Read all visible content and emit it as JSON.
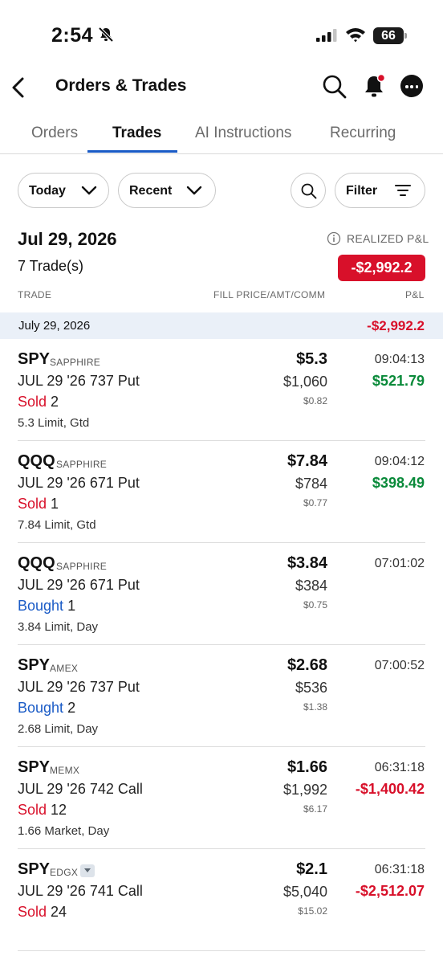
{
  "status_bar": {
    "time": "2:54",
    "battery": "66"
  },
  "header": {
    "title": "Orders & Trades"
  },
  "tabs": [
    {
      "label": "Orders"
    },
    {
      "label": "Trades",
      "active": true
    },
    {
      "label": "AI Instructions"
    },
    {
      "label": "Recurring"
    }
  ],
  "filters": {
    "period": "Today",
    "sort": "Recent",
    "filter_label": "Filter"
  },
  "summary": {
    "date": "Jul 29, 2026",
    "trade_count": "7 Trade(s)",
    "realized_label": "REALIZED P&L",
    "realized_value": "-$2,992.2"
  },
  "columns": {
    "trade": "TRADE",
    "fill": "FILL PRICE/AMT/COMM",
    "pl": "P&L"
  },
  "group": {
    "date": "July 29, 2026",
    "pl": "-$2,992.2"
  },
  "trades": [
    {
      "symbol": "SPY",
      "exchange": "SAPPHIRE",
      "contract": "JUL 29 '26 737 Put",
      "side": "Sold",
      "qty": "2",
      "order": "5.3 Limit, Gtd",
      "fill": "$5.3",
      "amount": "$1,060",
      "comm": "$0.82",
      "time": "09:04:13",
      "pl": "$521.79",
      "pl_sign": "pos"
    },
    {
      "symbol": "QQQ",
      "exchange": "SAPPHIRE",
      "contract": "JUL 29 '26 671 Put",
      "side": "Sold",
      "qty": "1",
      "order": "7.84 Limit, Gtd",
      "fill": "$7.84",
      "amount": "$784",
      "comm": "$0.77",
      "time": "09:04:12",
      "pl": "$398.49",
      "pl_sign": "pos"
    },
    {
      "symbol": "QQQ",
      "exchange": "SAPPHIRE",
      "contract": "JUL 29 '26 671 Put",
      "side": "Bought",
      "qty": "1",
      "order": "3.84 Limit, Day",
      "fill": "$3.84",
      "amount": "$384",
      "comm": "$0.75",
      "time": "07:01:02",
      "pl": "",
      "pl_sign": ""
    },
    {
      "symbol": "SPY",
      "exchange": "AMEX",
      "contract": "JUL 29 '26 737 Put",
      "side": "Bought",
      "qty": "2",
      "order": "2.68 Limit, Day",
      "fill": "$2.68",
      "amount": "$536",
      "comm": "$1.38",
      "time": "07:00:52",
      "pl": "",
      "pl_sign": ""
    },
    {
      "symbol": "SPY",
      "exchange": "MEMX",
      "contract": "JUL 29 '26 742 Call",
      "side": "Sold",
      "qty": "12",
      "order": "1.66 Market, Day",
      "fill": "$1.66",
      "amount": "$1,992",
      "comm": "$6.17",
      "time": "06:31:18",
      "pl": "-$1,400.42",
      "pl_sign": "neg"
    },
    {
      "symbol": "SPY",
      "exchange": "EDGX",
      "contract": "JUL 29 '26 741 Call",
      "side": "Sold",
      "qty": "24",
      "order": "",
      "fill": "$2.1",
      "amount": "$5,040",
      "comm": "$15.02",
      "time": "06:31:18",
      "pl": "-$2,512.07",
      "pl_sign": "neg",
      "has_dropdown": true
    }
  ],
  "colors": {
    "accent": "#1a5bc6",
    "negative": "#d8102a",
    "positive": "#0a8a3a",
    "group_bg": "#eaf0f8"
  }
}
